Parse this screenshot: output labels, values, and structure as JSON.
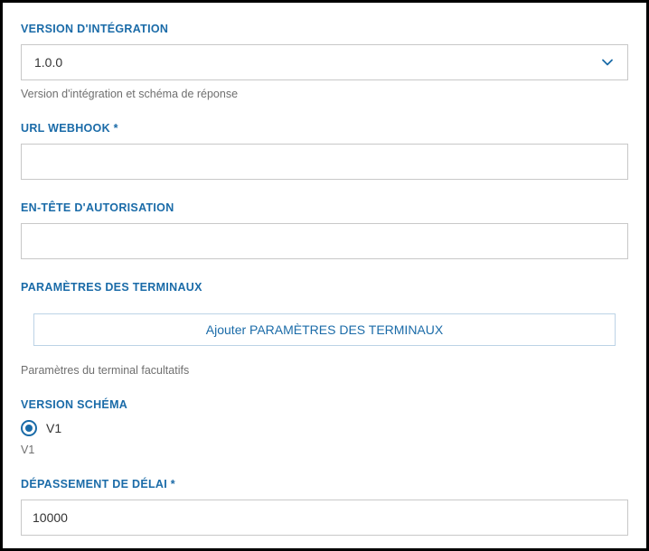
{
  "integrationVersion": {
    "label": "VERSION D'INTÉGRATION",
    "value": "1.0.0",
    "helper": "Version d'intégration et schéma de réponse"
  },
  "webhookUrl": {
    "label": "URL WEBHOOK *",
    "value": ""
  },
  "authHeader": {
    "label": "EN-TÊTE D'AUTORISATION",
    "value": ""
  },
  "terminalParams": {
    "label": "PARAMÈTRES DES TERMINAUX",
    "addButton": "Ajouter PARAMÈTRES DES TERMINAUX",
    "helper": "Paramètres du terminal facultatifs"
  },
  "schemaVersion": {
    "label": "VERSION SCHÉMA",
    "options": [
      {
        "label": "V1",
        "checked": true
      }
    ],
    "helper": "V1"
  },
  "timeout": {
    "label": "DÉPASSEMENT DE DÉLAI *",
    "value": "10000"
  }
}
